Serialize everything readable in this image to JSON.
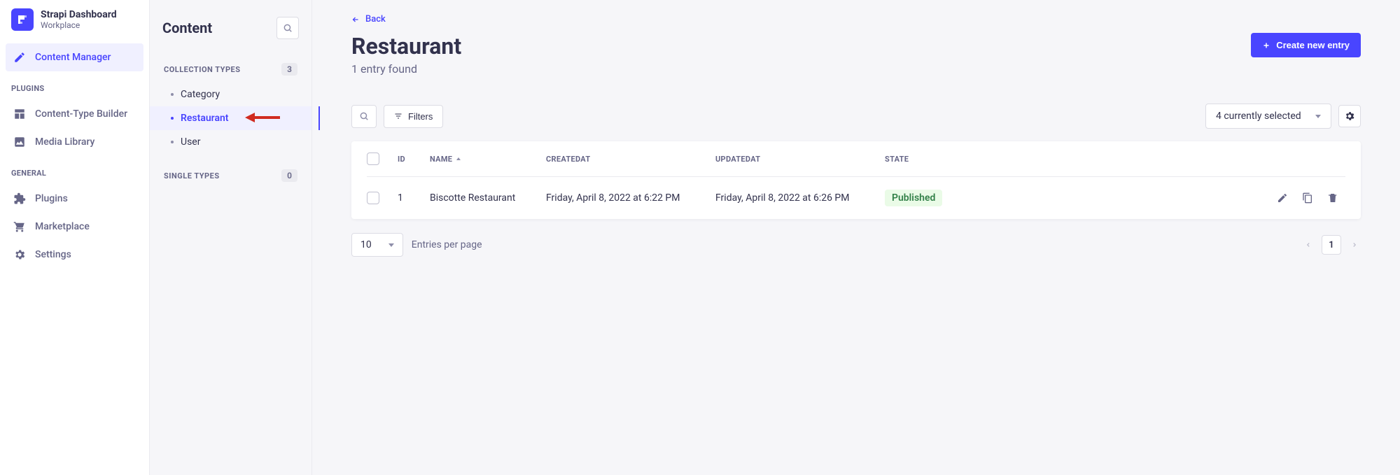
{
  "brand": {
    "title": "Strapi Dashboard",
    "subtitle": "Workplace"
  },
  "nav": {
    "contentManager": "Content Manager",
    "headings": {
      "plugins": "PLUGINS",
      "general": "GENERAL"
    },
    "items": {
      "contentTypeBuilder": "Content-Type Builder",
      "mediaLibrary": "Media Library",
      "plugins": "Plugins",
      "marketplace": "Marketplace",
      "settings": "Settings"
    }
  },
  "subnav": {
    "title": "Content",
    "sections": {
      "collection": {
        "label": "COLLECTION TYPES",
        "count": "3",
        "items": [
          "Category",
          "Restaurant",
          "User"
        ]
      },
      "single": {
        "label": "SINGLE TYPES",
        "count": "0"
      }
    }
  },
  "page": {
    "backLabel": "Back",
    "title": "Restaurant",
    "subtitle": "1 entry found",
    "createButton": "Create new entry",
    "filtersLabel": "Filters",
    "columnsSelected": "4 currently selected"
  },
  "table": {
    "headers": {
      "id": "ID",
      "name": "NAME",
      "createdAt": "CREATEDAT",
      "updatedAt": "UPDATEDAT",
      "state": "STATE"
    },
    "rows": [
      {
        "id": "1",
        "name": "Biscotte Restaurant",
        "createdAt": "Friday, April 8, 2022 at 6:22 PM",
        "updatedAt": "Friday, April 8, 2022 at 6:26 PM",
        "state": "Published"
      }
    ]
  },
  "footer": {
    "pageSize": "10",
    "entriesLabel": "Entries per page",
    "currentPage": "1"
  }
}
